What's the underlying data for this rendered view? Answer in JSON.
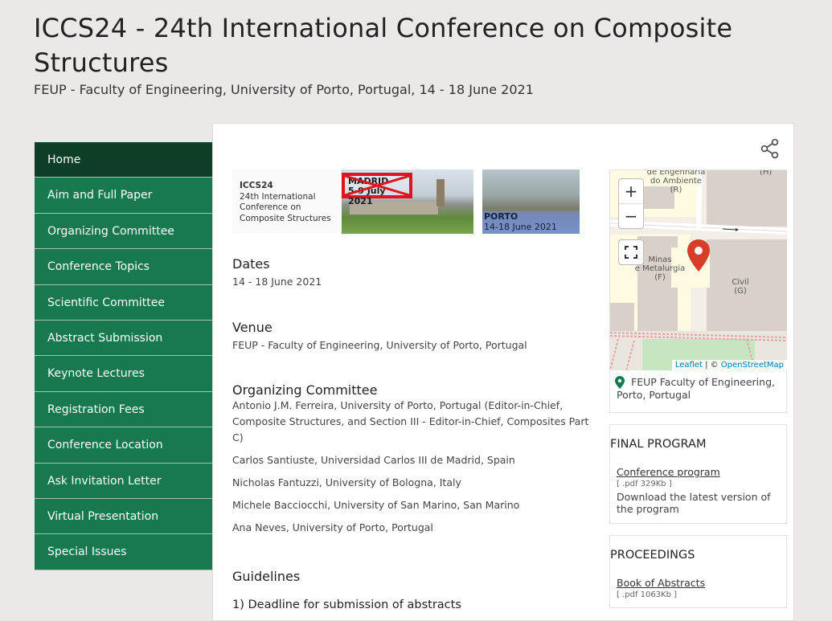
{
  "header": {
    "title": "ICCS24 - 24th International Conference on Composite Structures",
    "subtitle": "FEUP - Faculty of Engineering, University of Porto, Portugal, 14 - 18 June 2021"
  },
  "nav": {
    "items": [
      {
        "label": "Home",
        "active": true
      },
      {
        "label": "Aim and Full Paper"
      },
      {
        "label": "Organizing Committee"
      },
      {
        "label": "Conference Topics"
      },
      {
        "label": "Scientific Committee"
      },
      {
        "label": "Abstract Submission"
      },
      {
        "label": "Keynote Lectures"
      },
      {
        "label": "Registration Fees"
      },
      {
        "label": "Conference Location"
      },
      {
        "label": "Ask Invitation Letter"
      },
      {
        "label": "Virtual Presentation"
      },
      {
        "label": "Special Issues"
      }
    ]
  },
  "banner": {
    "logo_line1": "ICCS24",
    "logo_line2": "24th International",
    "logo_line3": "Conference on",
    "logo_line4": "Composite Structures",
    "madrid_city": "MADRID",
    "madrid_date": "5-9 July 2021",
    "porto_city": "PORTO",
    "porto_date": "14-18 June 2021"
  },
  "sections": {
    "dates_title": "Dates",
    "dates_text": "14 - 18 June 2021",
    "venue_title": "Venue",
    "venue_text": "FEUP - Faculty of Engineering, University of Porto, Portugal",
    "org_title": "Organizing Committee",
    "org_members": [
      "Antonio J.M. Ferreira, University of Porto, Portugal (Editor-in-Chief, Composite Structures, and Section III - Editor-in-Chief, Composites Part C)",
      "Carlos Santiuste, Universidad Carlos III de Madrid, Spain",
      "Nicholas Fantuzzi, University of Bologna, Italy",
      "Michele Bacciocchi, University of San Marino, San Marino",
      "Ana Neves, University of Porto, Portugal"
    ],
    "guidelines_title": "Guidelines",
    "guidelines_first": "1) Deadline for submission of abstracts"
  },
  "map": {
    "zoom_in": "+",
    "zoom_out": "−",
    "label_engenharia": "de Engenharia\ndo Ambiente\n(R)",
    "label_h": "(H)",
    "label_minas": "Minas\ne Metalurgia\n(F)",
    "label_civil": "Civil\n(G)",
    "attribution_leaflet": "Leaflet",
    "attribution_sep": " | © ",
    "attribution_osm": "OpenStreetMap",
    "address": "FEUP Faculty of Engineering, Porto, Portugal",
    "pin_color": "#d63e2a"
  },
  "final_program": {
    "title": "FINAL PROGRAM",
    "link": "Conference program",
    "meta": "[ .pdf 329Kb ]",
    "desc": "Download the latest version of the program"
  },
  "proceedings": {
    "title": "PROCEEDINGS",
    "link": "Book of Abstracts",
    "meta": "[ .pdf 1063Kb ]"
  },
  "colors": {
    "nav_bg": "#18794e",
    "nav_active": "#0d3f28",
    "page_bg": "#ebe9e8"
  }
}
